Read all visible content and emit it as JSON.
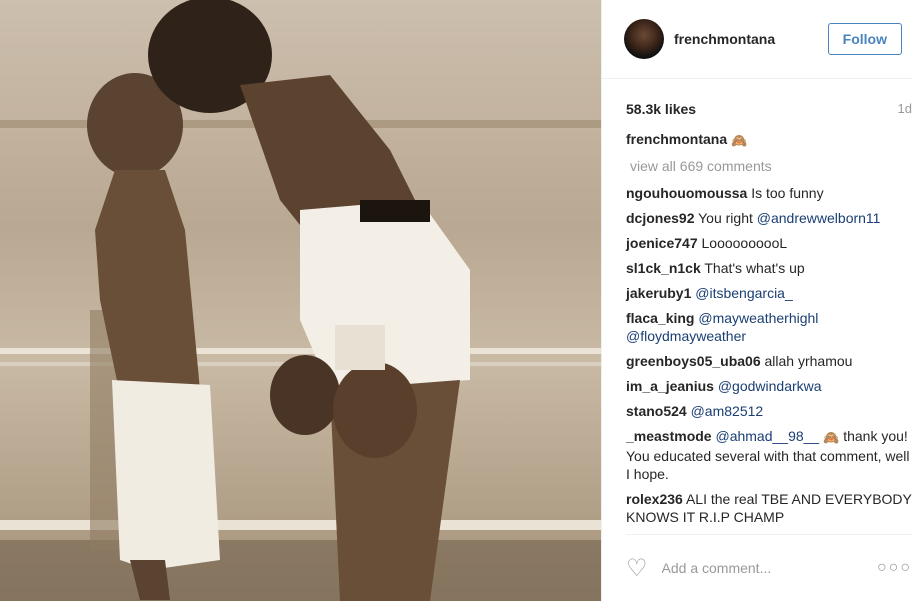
{
  "post": {
    "author": "frenchmontana",
    "follow_label": "Follow",
    "likes": "58.3k likes",
    "time": "1d",
    "caption_user": "frenchmontana",
    "caption_emoji": "🙈",
    "view_all": "view all 669 comments",
    "comments": [
      {
        "user": "ngouhouomoussa",
        "text": "Is too funny"
      },
      {
        "user": "dcjones92",
        "text": "You right ",
        "mention": "@andrewwelborn11"
      },
      {
        "user": "joenice747",
        "text": "LoooooooooL"
      },
      {
        "user": "sl1ck_n1ck",
        "text": "That's what's up"
      },
      {
        "user": "jakeruby1",
        "text": "",
        "mention": "@itsbengarcia_"
      },
      {
        "user": "flaca_king",
        "text": "",
        "mention": "@mayweatherhighl @floydmayweather"
      },
      {
        "user": "greenboys05_uba06",
        "text": "allah yrhamou"
      },
      {
        "user": "im_a_jeanius",
        "text": "",
        "mention": "@godwindarkwa"
      },
      {
        "user": "stano524",
        "text": "",
        "mention": "@am82512"
      },
      {
        "user": "_meastmode",
        "text_before": "",
        "mention": "@ahmad__98__",
        "emoji": "🙈",
        "text": " thank you! You educated several with that comment, well I hope."
      },
      {
        "user": "rolex236",
        "text": "ALI the real TBE AND EVERYBODY KNOWS IT R.I.P CHAMP"
      }
    ],
    "add_comment_placeholder": "Add a comment...",
    "more_glyph": "○○○",
    "heart_glyph": "♡"
  },
  "colors": {
    "follow_blue": "#4a84c0",
    "mention_blue": "#1b3e73",
    "muted": "#999999"
  }
}
